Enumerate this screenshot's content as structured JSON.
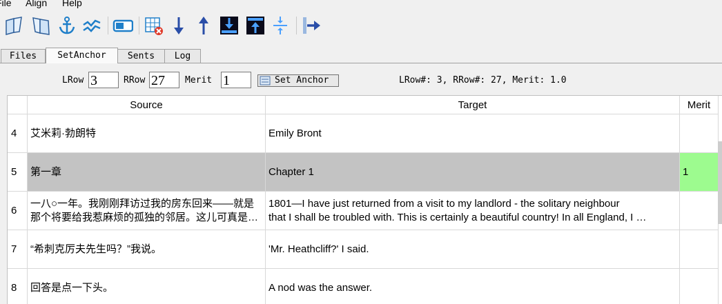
{
  "menu": {
    "file": "File",
    "align": "Align",
    "help": "Help"
  },
  "toolbar": {
    "icons": [
      "open-book-left-icon",
      "open-book-right-icon",
      "anchor-icon",
      "align-lines-icon",
      "toggle-icon",
      "delete-table-icon",
      "arrow-down-icon",
      "arrow-up-icon",
      "move-bottom-icon",
      "move-top-icon",
      "split-icon",
      "export-arrow-icon"
    ]
  },
  "tabs": [
    "Files",
    "SetAnchor",
    "Sents",
    "Log"
  ],
  "anchor": {
    "lrow_label": "LRow",
    "lrow_value": "3",
    "rrow_label": "RRow",
    "rrow_value": "27",
    "merit_label": "Merit",
    "merit_value": "1",
    "set_anchor_label": "Set Anchor",
    "status": "LRow#: 3, RRow#: 27, Merit: 1.0"
  },
  "table": {
    "headers": {
      "source": "Source",
      "target": "Target",
      "merit": "Merit"
    },
    "rows": [
      {
        "num": "4",
        "source": "艾米莉·勃朗特",
        "target": "Emily Bront",
        "merit": ""
      },
      {
        "num": "5",
        "source": "第一章",
        "target": "Chapter 1",
        "merit": "1"
      },
      {
        "num": "6",
        "source_l1": "一八○一年。我刚刚拜访过我的房东回来——就是",
        "source_l2": "那个将要给我惹麻烦的孤独的邻居。这儿可真是…",
        "target_l1": "1801—I have just returned from a visit to my landlord - the solitary neighbour",
        "target_l2": "that I shall be troubled with. This is certainly a beautiful country! In all England, I …",
        "merit": ""
      },
      {
        "num": "7",
        "source": "“希刺克厉夫先生吗？”我说。",
        "target": "'Mr. Heathcliff?' I said.",
        "merit": ""
      },
      {
        "num": "8",
        "source": "回答是点一下头。",
        "target": "A nod was the answer.",
        "merit": ""
      }
    ]
  },
  "colors": {
    "selected_row": "#c3c3c3",
    "merit_highlight": "#9dfb8f"
  }
}
